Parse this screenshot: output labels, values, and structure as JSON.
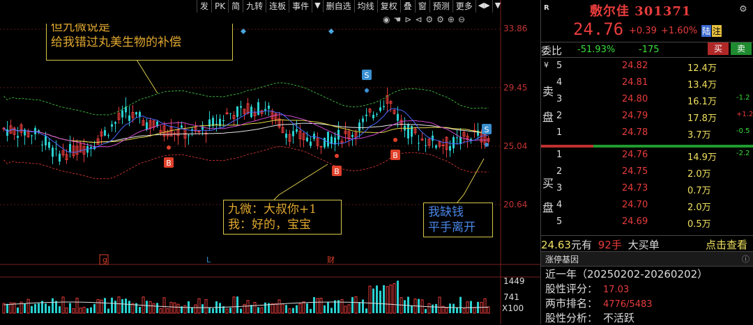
{
  "toolbar": {
    "items": [
      "发",
      "PK",
      "简",
      "九转",
      "连板",
      "事件",
      "▼",
      "删自选",
      "均线",
      "复权",
      "叠",
      "窗",
      "预测",
      "更多",
      "◀▶",
      "▼"
    ]
  },
  "chart": {
    "price_labels": [
      "33.86",
      "29.45",
      "25.04",
      "20.64"
    ],
    "volume_labels": [
      "1449",
      "741",
      "X100"
    ],
    "markers": {
      "buy": "B",
      "sell": "S"
    },
    "date_marks": [
      "g",
      "L",
      "财"
    ],
    "annotations": {
      "top_line1": "但九微说是",
      "top_line2": "给我错过丸美生物的补偿",
      "mid_line1": "九微：大叔你+1",
      "mid_line2": "我：好的，宝宝",
      "right_line1": "我缺钱",
      "right_line2": "平手离开"
    }
  },
  "chart_data": {
    "type": "line",
    "ylim": [
      18.5,
      35.5
    ],
    "price_ticks": [
      33.86,
      29.45,
      25.04,
      20.64
    ],
    "volume_ticks": [
      1449,
      741
    ]
  },
  "panel": {
    "badge": "R",
    "stock_name": "敷尔佳",
    "stock_code": "301371",
    "price": "24.76",
    "change": "+0.39",
    "change_pct": "+1.60%",
    "tag_lu": "陆",
    "tag_zhu": "注",
    "weibi_label": "委比",
    "weibi_value": "-51.93%",
    "weicha_value": "-175",
    "sell_btn": "买",
    "buy_btn": "卖",
    "sell_side": [
      "卖",
      "盘"
    ],
    "buy_side": [
      "买",
      "盘"
    ],
    "currency": "¥",
    "asks": [
      {
        "level": "5",
        "price": "24.82",
        "vol": "12.4万",
        "chg": ""
      },
      {
        "level": "4",
        "price": "24.81",
        "vol": "13.4万",
        "chg": ""
      },
      {
        "level": "3",
        "price": "24.80",
        "vol": "16.1万",
        "chg": "-1.2"
      },
      {
        "level": "2",
        "price": "24.79",
        "vol": "17.8万",
        "chg": "+1.2"
      },
      {
        "level": "1",
        "price": "24.78",
        "vol": "3.7万",
        "chg": "-0.5"
      }
    ],
    "bids": [
      {
        "level": "1",
        "price": "24.76",
        "vol": "14.9万",
        "chg": "-2.2"
      },
      {
        "level": "2",
        "price": "24.75",
        "vol": "2.0万",
        "chg": ""
      },
      {
        "level": "3",
        "price": "24.73",
        "vol": "0.7万",
        "chg": ""
      },
      {
        "level": "4",
        "price": "24.70",
        "vol": "2.0万",
        "chg": ""
      },
      {
        "level": "5",
        "price": "24.69",
        "vol": "0.5万",
        "chg": ""
      }
    ],
    "big_order_price": "24.63",
    "big_order_unit": "元有",
    "big_order_count": "92手",
    "big_order_label": "大买单",
    "big_order_link": "点击查看",
    "gene_title": "涨停基因",
    "gene_period": "近一年（20250202-20260202）",
    "score_label": "股性评分：",
    "score_value": "17.03",
    "rank_label": "两市排名：",
    "rank_value": "4776/5483",
    "analysis_label": "股性分析：",
    "analysis_value": "不活跃"
  }
}
